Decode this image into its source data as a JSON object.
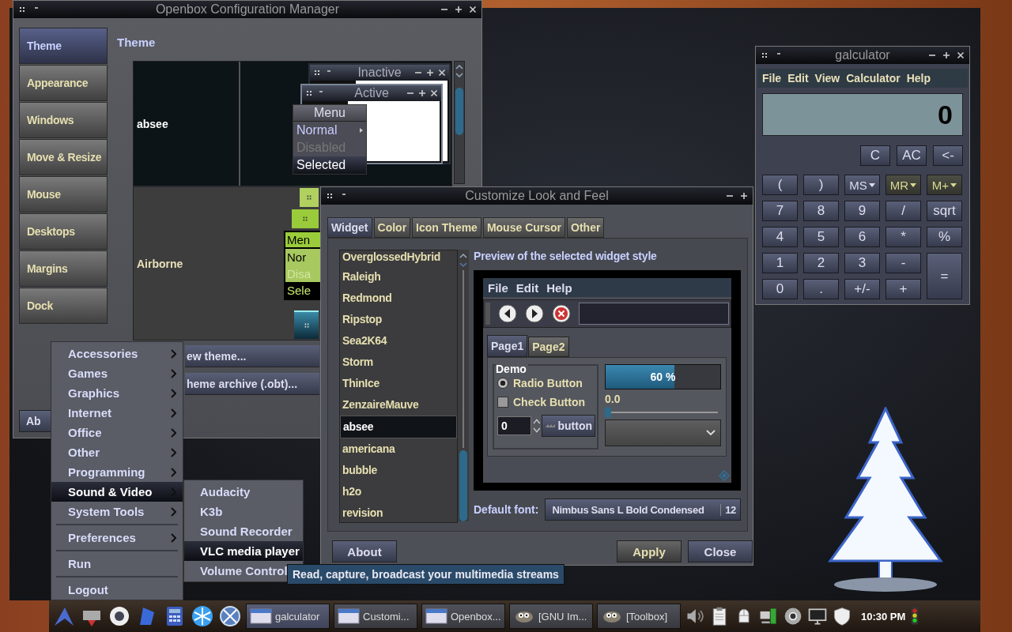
{
  "openbox": {
    "title": "Openbox Configuration Manager",
    "sidebar": [
      {
        "label": "Theme",
        "selected": true
      },
      {
        "label": "Appearance",
        "selected": false
      },
      {
        "label": "Windows",
        "selected": false
      },
      {
        "label": "Move & Resize",
        "selected": false
      },
      {
        "label": "Mouse",
        "selected": false
      },
      {
        "label": "Desktops",
        "selected": false
      },
      {
        "label": "Margins",
        "selected": false
      },
      {
        "label": "Dock",
        "selected": false
      }
    ],
    "heading": "Theme",
    "themes": [
      {
        "name": "absee",
        "kind": "absee",
        "preview": {
          "inactive": "Inactive",
          "active": "Active",
          "menu_title": "Menu",
          "items": [
            {
              "label": "Normal",
              "submenu": true,
              "disabled": false,
              "selected": false
            },
            {
              "label": "Disabled",
              "submenu": false,
              "disabled": true,
              "selected": false
            },
            {
              "label": "Selected",
              "submenu": false,
              "disabled": false,
              "selected": true
            }
          ]
        }
      },
      {
        "name": "Airborne",
        "kind": "airborne",
        "preview": {
          "menu_title": "Men",
          "items": [
            {
              "label": "Nor",
              "disabled": false,
              "selected": false
            },
            {
              "label": "Disa",
              "disabled": true,
              "selected": false
            },
            {
              "label": "Sele",
              "disabled": false,
              "selected": true
            }
          ]
        }
      }
    ],
    "actions": [
      "ew theme...",
      "heme archive (.obt)..."
    ],
    "about": "Ab"
  },
  "customize": {
    "title": "Customize Look and Feel",
    "tabs": [
      {
        "label": "Widget",
        "selected": true
      },
      {
        "label": "Color",
        "selected": false
      },
      {
        "label": "Icon Theme",
        "selected": false
      },
      {
        "label": "Mouse Cursor",
        "selected": false
      },
      {
        "label": "Other",
        "selected": false
      }
    ],
    "themes": [
      {
        "name": "OverglossedHybrid",
        "selected": false
      },
      {
        "name": "Raleigh",
        "selected": false
      },
      {
        "name": "Redmond",
        "selected": false
      },
      {
        "name": "Ripstop",
        "selected": false
      },
      {
        "name": "Sea2K64",
        "selected": false
      },
      {
        "name": "Storm",
        "selected": false
      },
      {
        "name": "ThinIce",
        "selected": false
      },
      {
        "name": "ZenzaireMauve",
        "selected": false
      },
      {
        "name": "absee",
        "selected": true
      },
      {
        "name": "americana",
        "selected": false
      },
      {
        "name": "bubble",
        "selected": false
      },
      {
        "name": "h2o",
        "selected": false
      },
      {
        "name": "revision",
        "selected": false
      }
    ],
    "preview_label": "Preview of the selected widget style",
    "preview": {
      "menu": [
        "File",
        "Edit",
        "Help"
      ],
      "pages": [
        {
          "label": "Page1",
          "selected": true
        },
        {
          "label": "Page2",
          "selected": false
        }
      ],
      "frame_title": "Demo",
      "radio": {
        "label": "Radio Button",
        "checked": true
      },
      "check": {
        "label": "Check Button",
        "checked": false
      },
      "spin_value": "0",
      "button": "button",
      "progress": {
        "level": 0.6,
        "text": "60 %"
      },
      "slider": {
        "reading": "0.0",
        "level": 0
      }
    },
    "font_label": "Default font:",
    "font": "Nimbus Sans L Bold Condensed",
    "font_size": "12",
    "about": "About",
    "apply": "Apply",
    "close": "Close"
  },
  "calculator": {
    "title": "galculator",
    "menu": [
      "File",
      "Edit",
      "View",
      "Calculator",
      "Help"
    ],
    "display": "0",
    "top_keys": [
      "C",
      "AC",
      "<-"
    ],
    "paren_keys": [
      "(",
      ")"
    ],
    "memory_keys": [
      {
        "label": "MS",
        "disabled": false
      },
      {
        "label": "MR",
        "disabled": true
      },
      {
        "label": "M+",
        "disabled": true
      }
    ],
    "keys": [
      {
        "label": "7",
        "kind": "plain"
      },
      {
        "label": "8",
        "kind": "plain"
      },
      {
        "label": "9",
        "kind": "plain"
      },
      {
        "label": "/",
        "kind": "plain"
      },
      {
        "label": "sqrt",
        "kind": "plain"
      },
      {
        "label": "4",
        "kind": "plain"
      },
      {
        "label": "5",
        "kind": "plain"
      },
      {
        "label": "6",
        "kind": "plain"
      },
      {
        "label": "*",
        "kind": "plain"
      },
      {
        "label": "%",
        "kind": "plain"
      },
      {
        "label": "1",
        "kind": "plain"
      },
      {
        "label": "2",
        "kind": "plain"
      },
      {
        "label": "3",
        "kind": "plain"
      },
      {
        "label": "-",
        "kind": "plain"
      },
      {
        "label": "=",
        "kind": "equals"
      },
      {
        "label": "0",
        "kind": "plain"
      },
      {
        "label": ".",
        "kind": "plain"
      },
      {
        "label": "+/-",
        "kind": "plain"
      },
      {
        "label": "+",
        "kind": "plain"
      }
    ]
  },
  "menu": {
    "groups": [
      [
        {
          "label": "Accessories",
          "submenu": true,
          "selected": false
        },
        {
          "label": "Games",
          "submenu": true,
          "selected": false
        },
        {
          "label": "Graphics",
          "submenu": true,
          "selected": false
        },
        {
          "label": "Internet",
          "submenu": true,
          "selected": false
        },
        {
          "label": "Office",
          "submenu": true,
          "selected": false
        },
        {
          "label": "Other",
          "submenu": true,
          "selected": false
        },
        {
          "label": "Programming",
          "submenu": true,
          "selected": false
        },
        {
          "label": "Sound & Video",
          "submenu": true,
          "selected": true
        },
        {
          "label": "System Tools",
          "submenu": true,
          "selected": false
        }
      ],
      [
        {
          "label": "Preferences",
          "submenu": true,
          "selected": false
        }
      ],
      [
        {
          "label": "Run",
          "submenu": false,
          "selected": false
        }
      ],
      [
        {
          "label": "Logout",
          "submenu": false,
          "selected": false
        }
      ]
    ],
    "submenu": [
      {
        "label": "Audacity",
        "selected": false
      },
      {
        "label": "K3b",
        "selected": false
      },
      {
        "label": "Sound Recorder",
        "selected": false
      },
      {
        "label": "VLC media player",
        "selected": true
      },
      {
        "label": "Volume Control",
        "selected": false
      }
    ],
    "tooltip": "Read, capture, broadcast your multimedia streams"
  },
  "taskbar": {
    "tasks": [
      {
        "label": "galculator",
        "kind": "window"
      },
      {
        "label": "Customi...",
        "kind": "window"
      },
      {
        "label": "Openbox...",
        "kind": "window"
      },
      {
        "label": "[GNU Im...",
        "kind": "gimp"
      },
      {
        "label": "[Toolbox]",
        "kind": "gimp"
      }
    ],
    "clock": "10:30 PM"
  }
}
